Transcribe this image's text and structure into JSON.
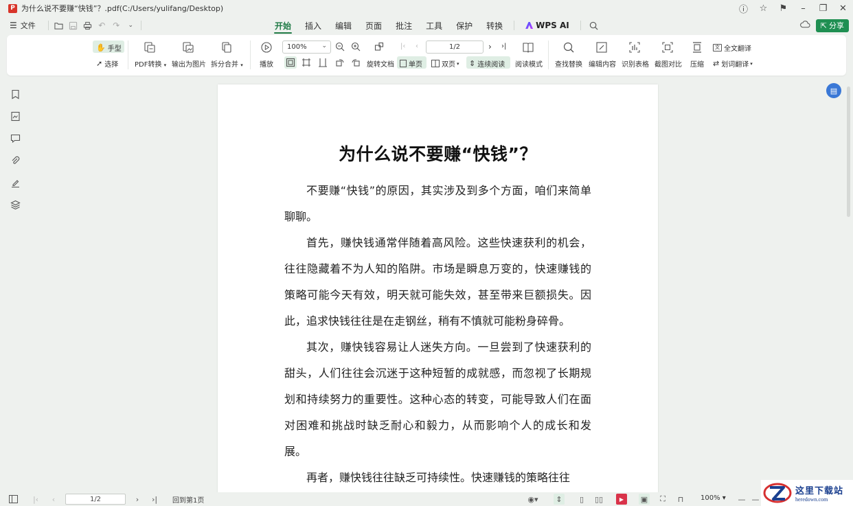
{
  "window": {
    "app_logo_glyph": "P",
    "title": "为什么说不要赚“快钱”？.pdf(C:/Users/yulifang/Desktop)"
  },
  "menubar": {
    "file_label": "文件",
    "tabs": [
      {
        "label": "开始",
        "active": true
      },
      {
        "label": "插入"
      },
      {
        "label": "编辑"
      },
      {
        "label": "页面"
      },
      {
        "label": "批注"
      },
      {
        "label": "工具"
      },
      {
        "label": "保护"
      },
      {
        "label": "转换"
      },
      {
        "label": "WPS AI"
      }
    ],
    "share_label": "分享"
  },
  "ribbon": {
    "hand_label": "手型",
    "select_label": "选择",
    "pdf_convert_label": "PDF转换",
    "export_image_label": "输出为图片",
    "split_merge_label": "拆分合并",
    "play_label": "播放",
    "zoom_value": "100%",
    "page_value": "1/2",
    "rotate_label": "旋转文档",
    "single_page_label": "单页",
    "double_page_label": "双页",
    "continuous_label": "连续阅读",
    "read_mode_label": "阅读模式",
    "find_replace_label": "查找替换",
    "edit_content_label": "编辑内容",
    "recognize_table_label": "识别表格",
    "screenshot_compare_label": "截图对比",
    "compress_label": "压缩",
    "full_translate_label": "全文翻译",
    "word_translate_label": "划词翻译"
  },
  "document": {
    "title": "为什么说不要赚“快钱”？",
    "paragraphs": [
      "不要赚“快钱”的原因，其实涉及到多个方面，咱们来简单聊聊。",
      "首先，赚快钱通常伴随着高风险。这些快速获利的机会，往往隐藏着不为人知的陷阱。市场是瞬息万变的，快速赚钱的策略可能今天有效，明天就可能失效，甚至带来巨额损失。因此，追求快钱往往是在走钢丝，稍有不慎就可能粉身碎骨。",
      "其次，赚快钱容易让人迷失方向。一旦尝到了快速获利的甜头，人们往往会沉迷于这种短暂的成就感，而忽视了长期规划和持续努力的重要性。这种心态的转变，可能导致人们在面对困难和挑战时缺乏耐心和毅力，从而影响个人的成长和发展。",
      "再者，赚快钱往往缺乏可持续性。快速赚钱的策略往往"
    ]
  },
  "statusbar": {
    "page_value": "1/2",
    "back_label": "回到第1页",
    "zoom_label": "100%"
  },
  "watermark": {
    "text_cn": "这里下载站",
    "text_url": "heredown.com"
  },
  "colors": {
    "accent": "#1f7a45",
    "share": "#1f8f52",
    "logo": "#d8352a"
  }
}
